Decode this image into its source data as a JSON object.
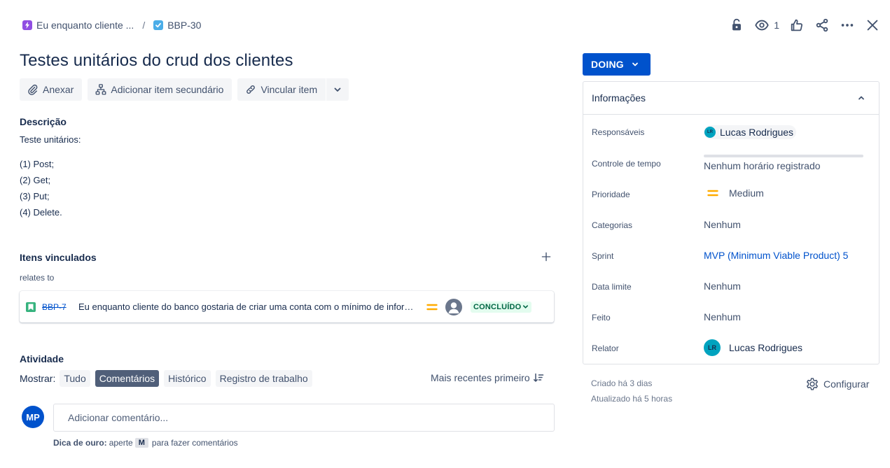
{
  "breadcrumb": {
    "epic_label": "Eu enquanto cliente ...",
    "separator": "/",
    "issue_key": "BBP-30",
    "epic_color": "#904ee2",
    "task_color": "#4bade8"
  },
  "top_actions": {
    "watch_count": "1",
    "icons": [
      "lock-icon",
      "eye-icon",
      "thumbs-up-icon",
      "share-icon",
      "more-icon",
      "close-icon"
    ]
  },
  "issue": {
    "title": "Testes unitários do crud dos clientes"
  },
  "toolbar": {
    "attach_label": "Anexar",
    "add_child_label": "Adicionar item secundário",
    "link_label": "Vincular item"
  },
  "description": {
    "label": "Descrição",
    "lines": [
      "Teste unitários:",
      "(1) Post;",
      "(2) Get;",
      "(3) Put;",
      "(4) Delete."
    ]
  },
  "linked": {
    "label": "Itens vinculados",
    "relation": "relates to",
    "item": {
      "key": "BBP-7",
      "summary": "Eu enquanto cliente do banco gostaria de criar uma conta com o mínimo de informações possíveis",
      "status": "CONCLUÍDO",
      "status_color": "#006644",
      "status_bg": "#e3fcef"
    }
  },
  "activity": {
    "label": "Atividade",
    "show_label": "Mostrar:",
    "filters": [
      "Tudo",
      "Comentários",
      "Histórico",
      "Registro de trabalho"
    ],
    "active_filter": "Comentários",
    "sort_label": "Mais recentes primeiro",
    "avatar_initials": "MP",
    "comment_placeholder": "Adicionar comentário...",
    "tip_bold": "Dica de ouro:",
    "tip_pre": "aperte",
    "tip_key": "M",
    "tip_post": "para fazer comentários"
  },
  "status_button": {
    "label": "DOING",
    "color": "#0052cc"
  },
  "details": {
    "header": "Informações",
    "fields": {
      "assignee_label": "Responsáveis",
      "assignee_initials": "LR",
      "assignee_name": "Lucas Rodrigues",
      "time_label": "Controle de tempo",
      "time_value": "Nenhum horário registrado",
      "priority_label": "Prioridade",
      "priority_value": "Medium",
      "priority_color": "#ffab00",
      "labels_label": "Categorias",
      "labels_value": "Nenhum",
      "sprint_label": "Sprint",
      "sprint_value": "MVP (Minimum Viable Product) 5",
      "due_label": "Data limite",
      "due_value": "Nenhum",
      "done_label": "Feito",
      "done_value": "Nenhum",
      "reporter_label": "Relator",
      "reporter_initials": "LR",
      "reporter_name": "Lucas Rodrigues"
    }
  },
  "meta": {
    "created": "Criado há 3 dias",
    "updated": "Atualizado há 5 horas",
    "configure_label": "Configurar"
  }
}
